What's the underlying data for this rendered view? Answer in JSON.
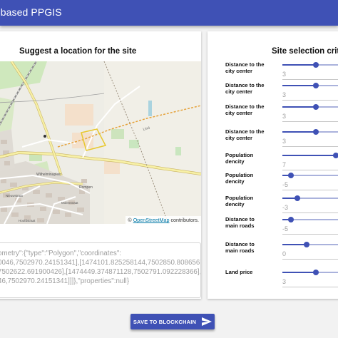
{
  "app": {
    "title": "-based PPGIS"
  },
  "left": {
    "title": "Suggest a location for the site",
    "map": {
      "attribution_link": "OpenStreetMap",
      "attribution_suffix": " contributors.",
      "labels": [
        "Wilhelminaplein",
        "Rompen",
        "Nieuwstraat",
        "Molenstraat",
        "Hoofdstraat",
        "Lind"
      ]
    },
    "geometry_text": "ometry\":{\"type\":\"Polygon\",\"coordinates\":\n0046,7502970.24151341],[1474101.825258144,7502850.808656714],\n7502622.691900426],[1474449.374871128,7502791.092228366],\n46,7502970.24151341]]]},\"properties\":null}"
  },
  "right": {
    "title": "Site selection criteri",
    "criteria": [
      {
        "label": "Distance to the city center",
        "value": "3",
        "level": 0.6
      },
      {
        "label": "Distance to the city center",
        "value": "3",
        "level": 0.6
      },
      {
        "label": "Distance to the city center",
        "value": "3",
        "level": 0.6
      },
      {
        "label": "Distance to the city center",
        "value": "3",
        "level": 0.6
      },
      {
        "label": "Population dencity",
        "value": "7",
        "level": 0.96
      },
      {
        "label": "Population dencity",
        "value": "-5",
        "level": 0.16
      },
      {
        "label": "Population dencity",
        "value": "-3",
        "level": 0.27
      },
      {
        "label": "Distance to main roads",
        "value": "-5",
        "level": 0.16
      },
      {
        "label": "Distance to main roads",
        "value": "0",
        "level": 0.44
      },
      {
        "label": "Land price",
        "value": "3",
        "level": 0.6
      }
    ]
  },
  "actions": {
    "save_label": "SAVE TO BLOCKCHAIN"
  },
  "colors": {
    "primary": "#3f51b5",
    "track": "#aab2dc"
  },
  "icons": {
    "send": "send-icon",
    "marker": "map-marker-icon"
  }
}
